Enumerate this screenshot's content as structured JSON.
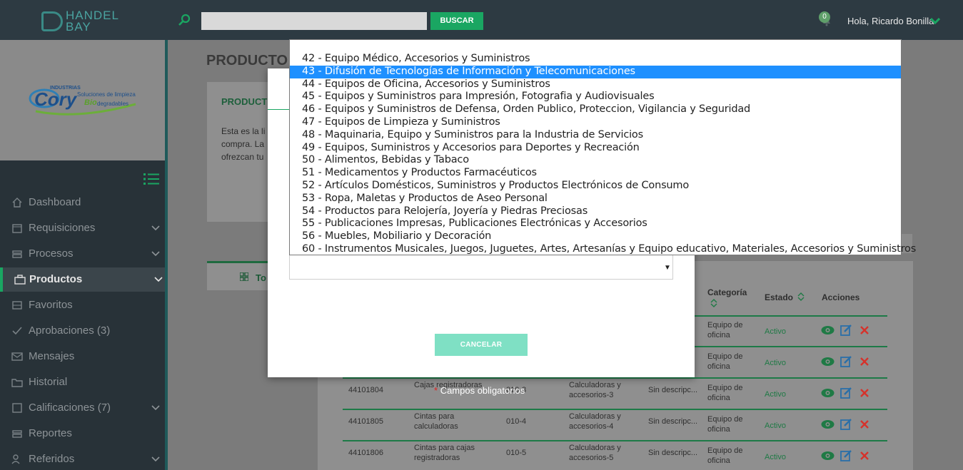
{
  "header": {
    "logo_line1": "HANDEL",
    "logo_line2": "BAY",
    "search_placeholder": "",
    "search_button": "BUSCAR",
    "notification_count": "0",
    "greeting": "Hola, Ricardo Bonilla"
  },
  "brand": {
    "top": "INDUSTRIAS",
    "name": "Cory",
    "tag1": "Soluciones de limpieza",
    "tag2a": "Bio",
    "tag2b": "degradables"
  },
  "sidebar": {
    "items": [
      {
        "label": "Dashboard",
        "icon": "home-icon",
        "caret": false
      },
      {
        "label": "Requisiciones",
        "icon": "calendar-icon",
        "caret": true
      },
      {
        "label": "Procesos",
        "icon": "stack-icon",
        "caret": true
      },
      {
        "label": "Productos",
        "icon": "briefcase-icon",
        "caret": true,
        "active": true
      },
      {
        "label": "Favoritos",
        "icon": "list-icon",
        "caret": false
      },
      {
        "label": "Aprobaciones (3)",
        "icon": "check-icon",
        "caret": false
      },
      {
        "label": "Mensajes",
        "icon": "envelope-icon",
        "caret": false
      },
      {
        "label": "Historial",
        "icon": "folder-icon",
        "caret": false
      },
      {
        "label": "Calificaciones (7)",
        "icon": "square-icon",
        "caret": true
      },
      {
        "label": "Reportes",
        "icon": "stack-icon",
        "caret": false
      },
      {
        "label": "Referidos",
        "icon": "users-icon",
        "caret": true
      }
    ]
  },
  "main": {
    "page_title": "PRODUCTO",
    "card_heading": "PRODUCT",
    "card_text_1": "Esta es la li",
    "card_text_2": "compra. La",
    "card_text_3": "ofrezcan tu",
    "tab_label": "To"
  },
  "table": {
    "headers": {
      "categoria": "Categoría",
      "estado": "Estado",
      "acciones": "Acciones"
    },
    "rows": [
      {
        "code": "",
        "name": "",
        "ref": "",
        "cat": "",
        "desc": "",
        "categoria": "Equipo de oficina",
        "estado": "Activo"
      },
      {
        "code": "",
        "name": "",
        "ref": "",
        "cat": "",
        "desc": "",
        "categoria": "Equipo de oficina",
        "estado": "Activo"
      },
      {
        "code": "44101804",
        "name": "Cajas registradoras",
        "ref": "010-3",
        "cat": "Calculadoras y accesorios-3",
        "desc": "Sin descripc...",
        "categoria": "Equipo de oficina",
        "estado": "Activo"
      },
      {
        "code": "44101805",
        "name": "Cintas para calculadoras",
        "ref": "010-4",
        "cat": "Calculadoras y accesorios-4",
        "desc": "Sin descripc...",
        "categoria": "Equipo de oficina",
        "estado": "Activo"
      },
      {
        "code": "44101806",
        "name": "Cintas para cajas registradoras",
        "ref": "010-5",
        "cat": "Calculadoras y accesorios-5",
        "desc": "Sin descripc...",
        "categoria": "Equipo de oficina",
        "estado": "Activo"
      }
    ]
  },
  "modal": {
    "cancel_button": "CANCELAR",
    "required_note": "Campos obligatorios",
    "required_star": "*"
  },
  "dropdown": {
    "selected_index": 1,
    "options": [
      "42 - Equipo Médico, Accesorios y Suministros",
      "43 - Difusión de Tecnologías de Información y Telecomunicaciones",
      "44 - Equipos de Oficina, Accesorios y Suministros",
      "45 - Equipos y Suministros para Impresión, Fotografia y Audiovisuales",
      "46 - Equipos y Suministros de Defensa, Orden Publico, Proteccion, Vigilancia y Seguridad",
      "47 - Equipos de Limpieza y Suministros",
      "48 - Maquinaria, Equipo y Suministros para la Industria de Servicios",
      "49 - Equipos, Suministros y Accesorios para Deportes y Recreación",
      "50 - Alimentos, Bebidas y Tabaco",
      "51 - Medicamentos y Productos Farmacéuticos",
      "52 - Artículos Domésticos, Suministros y Productos Electrónicos de Consumo",
      "53 - Ropa, Maletas y Productos de Aseo Personal",
      "54 - Productos para Relojería, Joyería y Piedras Preciosas",
      "55 - Publicaciones Impresas, Publicaciones Electrónicas y Accesorios",
      "56 - Muebles, Mobiliario y Decoración",
      "60 - Instrumentos Musicales, Juegos, Juguetes, Artes, Artesanías y Equipo educativo, Materiales, Accesorios y Suministros"
    ]
  },
  "colors": {
    "accent_green": "#1aa662",
    "topbar": "#2d3a42",
    "sidebar": "#283238",
    "selection_blue": "#1e90ff"
  }
}
